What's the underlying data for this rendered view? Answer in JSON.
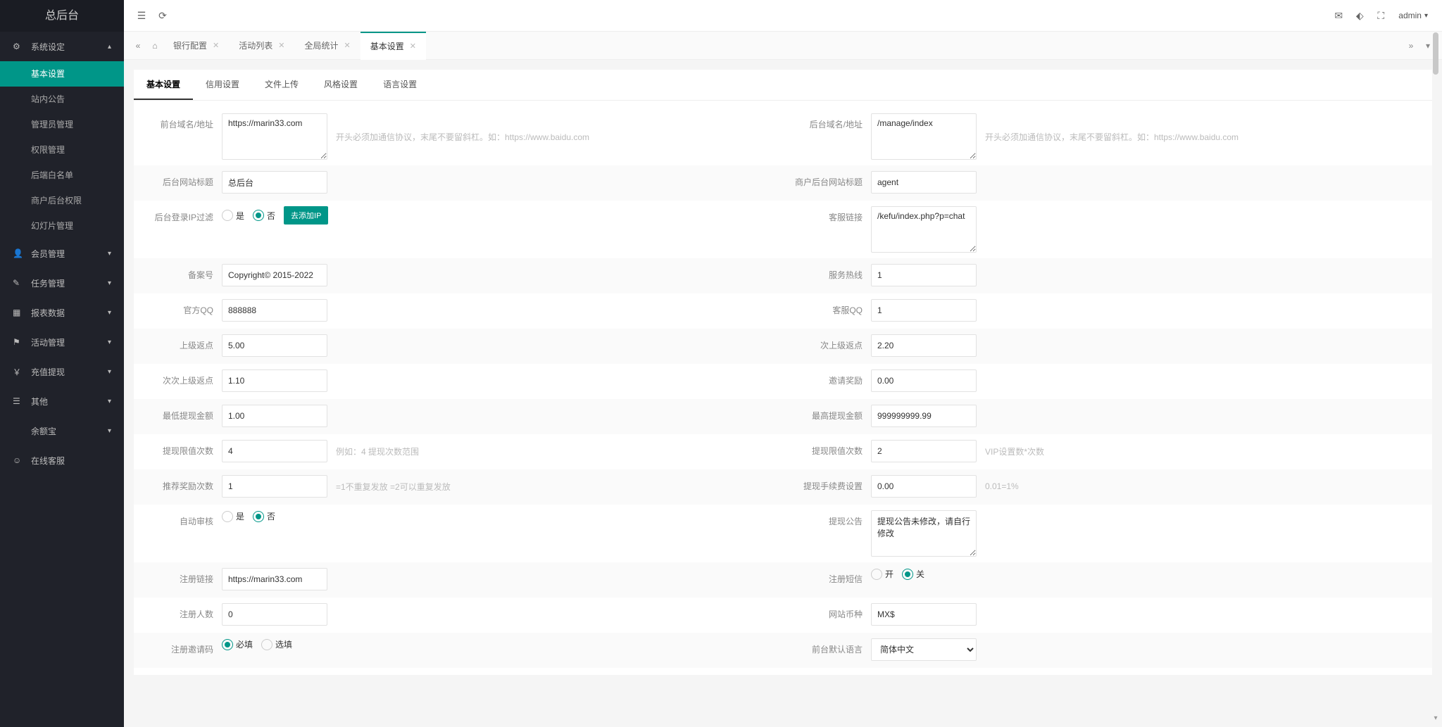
{
  "brand": "总后台",
  "user": {
    "name": "admin"
  },
  "sidebar": {
    "groups": [
      {
        "label": "系统设定",
        "icon": "⚙",
        "expanded": true,
        "items": [
          "基本设置",
          "站内公告",
          "管理员管理",
          "权限管理",
          "后端白名单",
          "商户后台权限",
          "幻灯片管理"
        ],
        "active": 0
      },
      {
        "label": "会员管理",
        "icon": "👤",
        "expanded": false
      },
      {
        "label": "任务管理",
        "icon": "✎",
        "expanded": false
      },
      {
        "label": "报表数据",
        "icon": "▦",
        "expanded": false
      },
      {
        "label": "活动管理",
        "icon": "⚑",
        "expanded": false
      },
      {
        "label": "充值提现",
        "icon": "￥",
        "expanded": false
      },
      {
        "label": "其他",
        "icon": "☰",
        "expanded": false
      },
      {
        "label": "余额宝",
        "icon": " ",
        "expanded": false,
        "noicon": true
      },
      {
        "label": "在线客服",
        "icon": "☺",
        "expanded": false,
        "nochev": true
      }
    ]
  },
  "tabs": [
    "银行配置",
    "活动列表",
    "全局统计",
    "基本设置"
  ],
  "tabs_active": 3,
  "panel_tabs": [
    "基本设置",
    "信用设置",
    "文件上传",
    "风格设置",
    "语言设置"
  ],
  "panel_active": 0,
  "form": {
    "front_domain": {
      "label": "前台域名/地址",
      "value": "https://marin33.com",
      "hint": "开头必须加通信协议，末尾不要留斜杠。如：https://www.baidu.com"
    },
    "back_domain": {
      "label": "后台域名/地址",
      "value": "/manage/index",
      "hint": "开头必须加通信协议，末尾不要留斜杠。如：https://www.baidu.com"
    },
    "back_title": {
      "label": "后台网站标题",
      "value": "总后台"
    },
    "agent_title": {
      "label": "商户后台网站标题",
      "value": "agent"
    },
    "ip_filter": {
      "label": "后台登录IP过滤",
      "yes": "是",
      "no": "否",
      "value": "no",
      "btn": "去添加IP"
    },
    "kefu_link": {
      "label": "客服链接",
      "value": "/kefu/index.php?p=chat"
    },
    "beian": {
      "label": "备案号",
      "value": "Copyright© 2015-2022"
    },
    "hotline": {
      "label": "服务热线",
      "value": "1"
    },
    "qq": {
      "label": "官方QQ",
      "value": "888888"
    },
    "kefu_qq": {
      "label": "客服QQ",
      "value": "1"
    },
    "rebate_up": {
      "label": "上级返点",
      "value": "5.00"
    },
    "rebate_up2": {
      "label": "次上级返点",
      "value": "2.20"
    },
    "rebate_up3": {
      "label": "次次上级返点",
      "value": "1.10"
    },
    "invite_reward": {
      "label": "邀请奖励",
      "value": "0.00"
    },
    "withdraw_min": {
      "label": "最低提现金额",
      "value": "1.00"
    },
    "withdraw_max": {
      "label": "最高提现金额",
      "value": "999999999.99"
    },
    "withdraw_limit": {
      "label": "提现限值次数",
      "value": "4",
      "hint": "例如：4 提现次数范围"
    },
    "withdraw_limit2": {
      "label": "提现限值次数",
      "value": "2",
      "hint": "VIP设置数*次数"
    },
    "recommend_cnt": {
      "label": "推荐奖励次数",
      "value": "1",
      "hint": "=1不重复发放  =2可以重复发放"
    },
    "withdraw_fee": {
      "label": "提现手续费设置",
      "value": "0.00",
      "hint": "0.01=1%"
    },
    "auto_audit": {
      "label": "自动审核",
      "yes": "是",
      "no": "否",
      "value": "no"
    },
    "withdraw_notice": {
      "label": "提现公告",
      "value": "提现公告未修改，请自行修改"
    },
    "reg_link": {
      "label": "注册链接",
      "value": "https://marin33.com"
    },
    "reg_sms": {
      "label": "注册短信",
      "on": "开",
      "off": "关",
      "value": "off"
    },
    "reg_count": {
      "label": "注册人数",
      "value": "0"
    },
    "currency": {
      "label": "网站币种",
      "value": "MX$"
    },
    "reg_invite": {
      "label": "注册邀请码",
      "req": "必填",
      "opt": "选填",
      "value": "req"
    },
    "default_lang": {
      "label": "前台默认语言",
      "value": "简体中文"
    }
  }
}
